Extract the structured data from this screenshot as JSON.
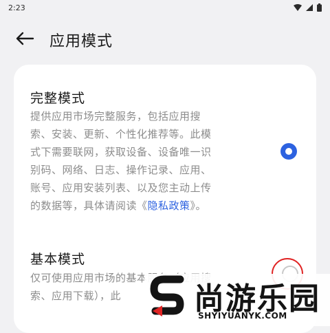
{
  "status_bar": {
    "time": "2:23",
    "icons": [
      "wifi-icon",
      "cellular-icon",
      "battery-icon"
    ]
  },
  "header": {
    "back_icon": "arrow-left-icon",
    "title": "应用模式"
  },
  "modes": [
    {
      "title": "完整模式",
      "description_lines": [
        "提供应用市场完整服务，包括应用搜",
        "索、安装、更新、个性化推荐等。此模",
        "式下需要联网，获取设备、设备唯一识",
        "别码、网络、日志、操作记录、应用、",
        "账号、应用安装列表、以及您主动上传"
      ],
      "last_line_prefix": "的数据等，具体请阅读《",
      "privacy_link": "隐私政策",
      "last_line_suffix": "》。",
      "selected": true
    },
    {
      "title": "基本模式",
      "description_lines": [
        "仅可使用应用市场的基本服务（应用搜",
        "索、应用下载），此"
      ],
      "selected": false
    }
  ],
  "watermark": {
    "text": "尚游乐园",
    "url": "SHYIYUANYK.COM"
  },
  "colors": {
    "accent": "#2d62e0",
    "background": "#f1f1f3",
    "card": "#ffffff",
    "muted_text": "#8c8c8c"
  }
}
